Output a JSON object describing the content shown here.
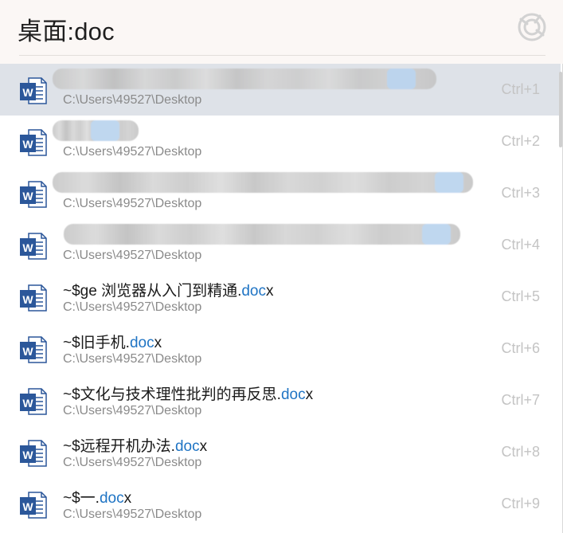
{
  "search": {
    "query": "桌面:doc"
  },
  "results": [
    {
      "title_prefix": "",
      "title_highlight": "",
      "title_suffix": "",
      "path": "C:\\Users\\49527\\Desktop",
      "shortcut": "Ctrl+1",
      "redacted": true
    },
    {
      "title_prefix": "",
      "title_highlight": "",
      "title_suffix": "",
      "path": "C:\\Users\\49527\\Desktop",
      "shortcut": "Ctrl+2",
      "redacted": true
    },
    {
      "title_prefix": "",
      "title_highlight": "",
      "title_suffix": "",
      "path": "C:\\Users\\49527\\Desktop",
      "shortcut": "Ctrl+3",
      "redacted": true
    },
    {
      "title_prefix": "",
      "title_highlight": "",
      "title_suffix": "",
      "path": "C:\\Users\\49527\\Desktop",
      "shortcut": "Ctrl+4",
      "redacted": true
    },
    {
      "title_prefix": "~$ge 浏览器从入门到精通.",
      "title_highlight": "doc",
      "title_suffix": "x",
      "path": "C:\\Users\\49527\\Desktop",
      "shortcut": "Ctrl+5",
      "redacted": false
    },
    {
      "title_prefix": "~$旧手机.",
      "title_highlight": "doc",
      "title_suffix": "x",
      "path": "C:\\Users\\49527\\Desktop",
      "shortcut": "Ctrl+6",
      "redacted": false
    },
    {
      "title_prefix": "~$文化与技术理性批判的再反思.",
      "title_highlight": "doc",
      "title_suffix": "x",
      "path": "C:\\Users\\49527\\Desktop",
      "shortcut": "Ctrl+7",
      "redacted": false
    },
    {
      "title_prefix": "~$远程开机办法.",
      "title_highlight": "doc",
      "title_suffix": "x",
      "path": "C:\\Users\\49527\\Desktop",
      "shortcut": "Ctrl+8",
      "redacted": false
    },
    {
      "title_prefix": "~$一.",
      "title_highlight": "doc",
      "title_suffix": "x",
      "path": "C:\\Users\\49527\\Desktop",
      "shortcut": "Ctrl+9",
      "redacted": false
    }
  ],
  "icons": {
    "result": "word-document-icon",
    "app_logo": "app-logo-icon"
  },
  "colors": {
    "highlight": "#1f74c4",
    "selected_row": "#dee2e8",
    "word_blue": "#2b579a"
  },
  "selected_index": 0
}
